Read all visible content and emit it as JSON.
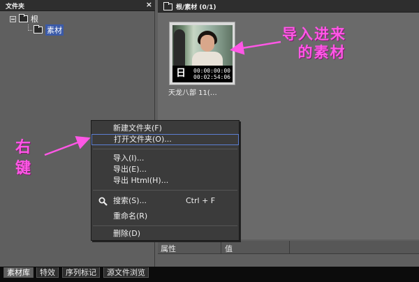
{
  "left_panel": {
    "title": "文件夹",
    "close": "×",
    "tree": [
      {
        "label": "根"
      },
      {
        "label": "素材"
      }
    ]
  },
  "right_panel": {
    "title": "根/素材 (0/1)",
    "clip": {
      "name": "天龙八部 11(…",
      "sun": "日",
      "in_tc": "00:00:00:00",
      "duration_tc": "00:02:54:06"
    }
  },
  "annotations": {
    "import_line1": "导入进来",
    "import_line2": "的素材",
    "right_click": "右键"
  },
  "properties": {
    "col1": "属性",
    "col2": "值"
  },
  "context_menu": {
    "new_folder": "新建文件夹(F)",
    "open_folder": "打开文件夹(O)...",
    "import": "导入(I)...",
    "export": "导出(E)...",
    "export_html": "导出 Html(H)...",
    "search": "搜索(S)...",
    "search_shortcut": "Ctrl + F",
    "rename": "重命名(R)",
    "delete": "删除(D)"
  },
  "tabs": [
    "素材库",
    "特效",
    "序列标记",
    "源文件浏览"
  ],
  "colors": {
    "annotation": "#ff57e6",
    "menu_highlight_border": "#5d7fd2"
  }
}
